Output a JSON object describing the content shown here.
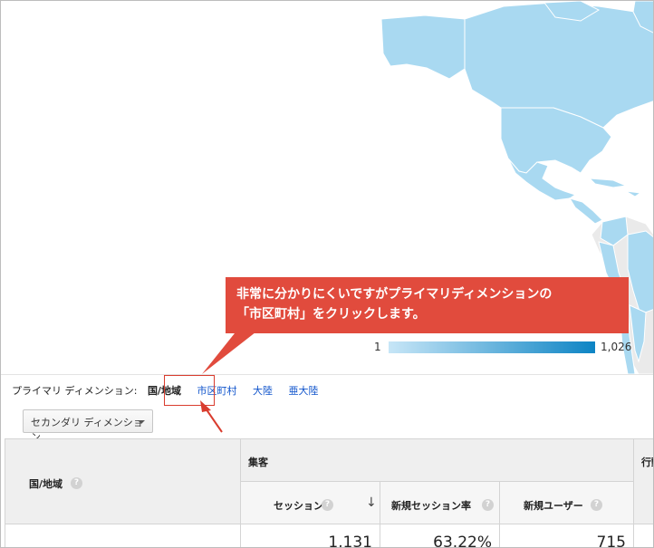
{
  "map": {
    "legend_min": "1",
    "legend_max": "1,026",
    "colors": {
      "high": "#0d84c4",
      "low": "#c7e6f7",
      "country": "#a9d9f1",
      "no_data": "#eaeaea"
    }
  },
  "callout": {
    "line1": "非常に分かりにくいですがプライマリディメンションの",
    "line2": "「市区町村」をクリックします。",
    "color": "#e14b3d"
  },
  "primary_dimension": {
    "label": "プライマリ ディメンション:",
    "active": "国/地域",
    "options": [
      "市区町村",
      "大陸",
      "亜大陸"
    ]
  },
  "secondary_dimension": {
    "label": "セカンダリ ディメンション"
  },
  "table": {
    "country_header": "国/地域",
    "acquisition_header": "集客",
    "behavior_header": "行動",
    "columns": [
      "セッション",
      "新規セッション率",
      "新規ユーザー"
    ],
    "help_glyph": "?",
    "sort_glyph": "↓",
    "totals": [
      "1,131",
      "63.22%",
      "715"
    ]
  }
}
